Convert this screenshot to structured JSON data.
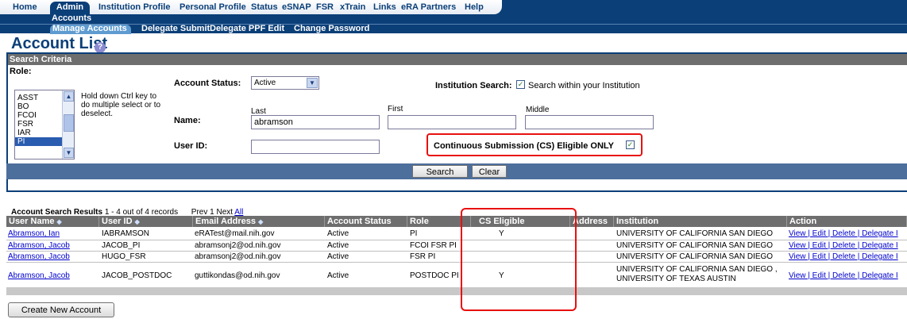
{
  "nav": {
    "items": [
      "Home",
      "Institution Profile",
      "Personal Profile",
      "Status",
      "eSNAP",
      "FSR",
      "xTrain",
      "Links",
      "eRA Partners",
      "Help"
    ],
    "active": "Admin",
    "sub1": "Accounts",
    "sub2": [
      "Manage Accounts",
      "Delegate Submit",
      "Delegate PPF Edit",
      "Change Password"
    ]
  },
  "page": {
    "title": "Account List",
    "help": "?"
  },
  "criteria": {
    "header": "Search Criteria",
    "role_label": "Role:",
    "roles": [
      "ASST",
      "BO",
      "FCOI",
      "FSR",
      "IAR",
      "PI"
    ],
    "selected_role": "PI",
    "role_help": "Hold down Ctrl key to do multiple select or to deselect.",
    "account_status_label": "Account Status:",
    "account_status_value": "Active",
    "institution_search_label": "Institution Search:",
    "institution_search_text": "Search within your Institution",
    "name_label": "Name:",
    "last_label": "Last",
    "first_label": "First",
    "middle_label": "Middle",
    "last_value": "abramson",
    "first_value": "",
    "middle_value": "",
    "userid_label": "User ID:",
    "userid_value": "",
    "cs_label": "Continuous Submission (CS) Eligible ONLY",
    "search_button": "Search",
    "clear_button": "Clear"
  },
  "results": {
    "title": "Account Search Results",
    "range": "1 - 4 out of 4 records",
    "pager_prev": "Prev",
    "pager_page": "1",
    "pager_next": "Next",
    "pager_all": "All",
    "columns": [
      "User Name",
      "User ID",
      "Email Address",
      "Account Status",
      "Role",
      "CS Eligible",
      "Address",
      "Institution",
      "Action"
    ],
    "rows": [
      {
        "name": "Abramson, Ian",
        "userid": "IABRAMSON",
        "email": "eRATest@mail.nih.gov",
        "status": "Active",
        "role": "PI",
        "cs": "Y",
        "institution": "UNIVERSITY OF CALIFORNIA SAN DIEGO",
        "institution2": "",
        "action": "View | Edit | Delete | Delegate I"
      },
      {
        "name": "Abramson, Jacob",
        "userid": "JACOB_PI",
        "email": "abramsonj2@od.nih.gov",
        "status": "Active",
        "role": "FCOI  FSR  PI",
        "cs": "",
        "institution": "UNIVERSITY OF CALIFORNIA SAN DIEGO",
        "institution2": "",
        "action": "View | Edit | Delete | Delegate I"
      },
      {
        "name": "Abramson, Jacob",
        "userid": "HUGO_FSR",
        "email": "abramsonj2@od.nih.gov",
        "status": "Active",
        "role": "FSR  PI",
        "cs": "",
        "institution": "UNIVERSITY OF CALIFORNIA SAN DIEGO",
        "institution2": "",
        "action": "View | Edit | Delete | Delegate I"
      },
      {
        "name": "Abramson, Jacob",
        "userid": "JACOB_POSTDOC",
        "email": "guttikondas@od.nih.gov",
        "status": "Active",
        "role": "POSTDOC  PI",
        "cs": "Y",
        "institution": "UNIVERSITY OF CALIFORNIA SAN DIEGO ,",
        "institution2": "UNIVERSITY OF TEXAS AUSTIN",
        "action": "View | Edit | Delete | Delegate I"
      }
    ],
    "create_button": "Create New Account"
  },
  "colors": {
    "navy": "#0b3f78",
    "header_gray": "#6e6e6e",
    "highlight_red": "#e81010",
    "link": "#0000cc"
  }
}
